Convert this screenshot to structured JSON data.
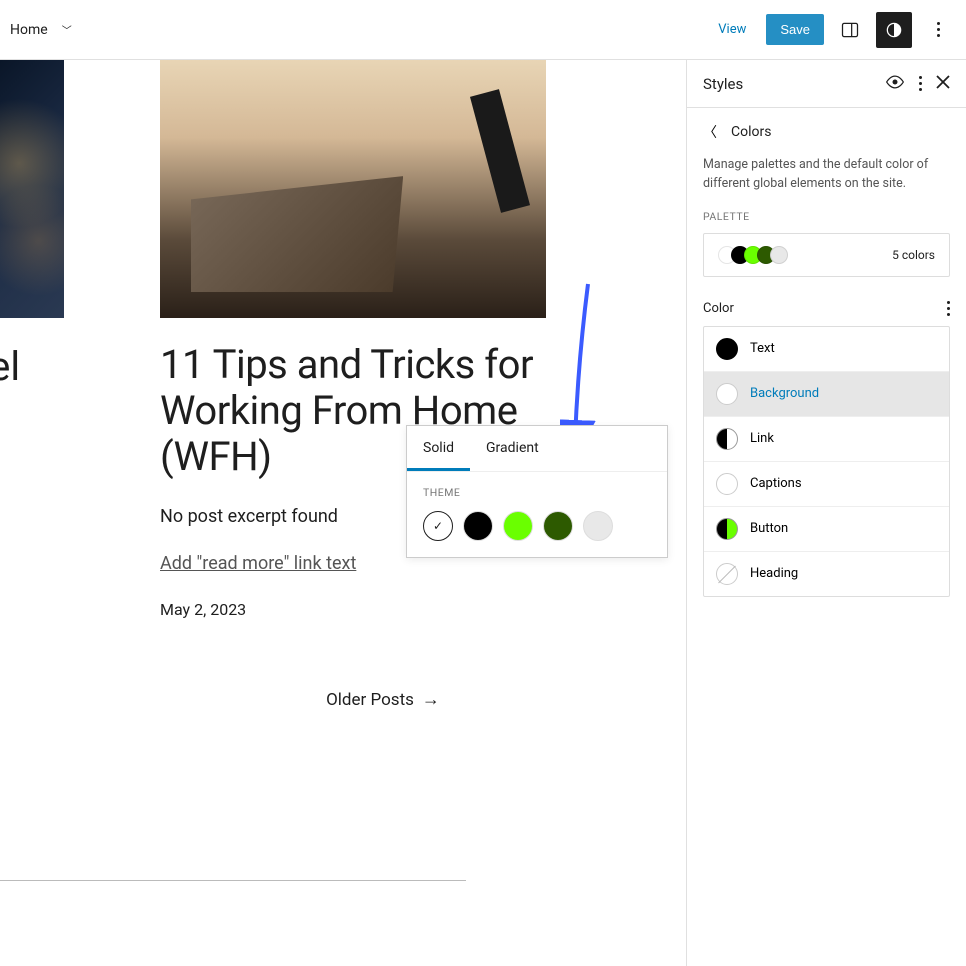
{
  "topbar": {
    "home": "Home",
    "view": "View",
    "save": "Save"
  },
  "canvas": {
    "left_title_fragment": "vel",
    "post_title": "11 Tips and Tricks for Working From Home (WFH)",
    "excerpt": "No post excerpt found",
    "read_more": "Add \"read more\" link text",
    "date": "May 2, 2023",
    "older_posts": "Older Posts"
  },
  "popover": {
    "tab_solid": "Solid",
    "tab_gradient": "Gradient",
    "theme_label": "THEME",
    "swatches": [
      "#ffffff",
      "#000000",
      "#6aff00",
      "#2d5a00",
      "#e8e8e8"
    ],
    "selected_index": 0
  },
  "sidebar": {
    "title": "Styles",
    "back_title": "Colors",
    "description": "Manage palettes and the default color of different global elements on the site.",
    "palette_label": "PALETTE",
    "palette_swatches": [
      "#ffffff",
      "#000000",
      "#6aff00",
      "#2d5a00",
      "#e8e8e8"
    ],
    "palette_count": "5 colors",
    "color_label": "Color",
    "rows": [
      {
        "name": "Text",
        "indicator": "ind-solid-black"
      },
      {
        "name": "Background",
        "indicator": "ind-white",
        "highlight": true
      },
      {
        "name": "Link",
        "indicator": "ind-split-bw"
      },
      {
        "name": "Captions",
        "indicator": "ind-white"
      },
      {
        "name": "Button",
        "indicator": "ind-split-bg"
      },
      {
        "name": "Heading",
        "indicator": "ind-empty"
      }
    ]
  }
}
